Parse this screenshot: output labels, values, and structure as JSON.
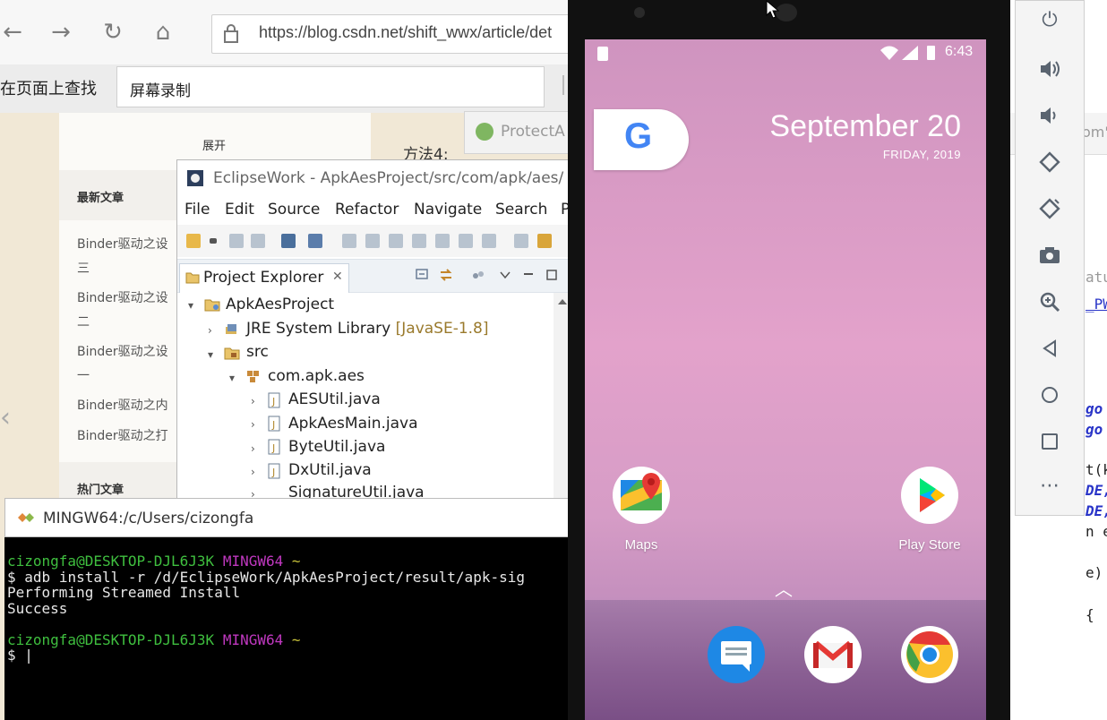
{
  "browser": {
    "url": "https://blog.csdn.net/shift_wwx/article/det",
    "find_label": "在页面上查找",
    "find_value": "屏幕录制",
    "sidebar": {
      "collapse": "展开",
      "latest_header": "最新文章",
      "latest_items": [
        "Binder驱动之设",
        "三",
        "Binder驱动之设",
        "二",
        "Binder驱动之设",
        "一",
        "Binder驱动之内",
        "Binder驱动之打"
      ],
      "hot_header": "热门文章"
    },
    "content_snippet": "方法4:"
  },
  "protect_window": {
    "title": "ProtectA"
  },
  "eclipse": {
    "title": "EclipseWork - ApkAesProject/src/com/apk/aes/",
    "menu": [
      "File",
      "Edit",
      "Source",
      "Refactor",
      "Navigate",
      "Search",
      "P"
    ],
    "view_tab": "Project Explorer",
    "tree": {
      "project": "ApkAesProject",
      "jre": "JRE System Library",
      "jre_decoration": "[JavaSE-1.8]",
      "src": "src",
      "package": "com.apk.aes",
      "files": [
        "AESUtil.java",
        "ApkAesMain.java",
        "ByteUtil.java",
        "DxUtil.java",
        "SignatureUtil.java"
      ]
    }
  },
  "terminal": {
    "title": "MINGW64:/c/Users/cizongfa",
    "user_host": "cizongfa@DESKTOP-DJL6J3K",
    "shell": "MINGW64",
    "cwd": "~",
    "prompt": "$",
    "command": "adb install -r /d/EclipseWork/ApkAesProject/result/apk-sig",
    "out1": "Performing Streamed Install",
    "out2": "Success",
    "cursor": "|"
  },
  "phone": {
    "time": "6:43",
    "google_letter": "G",
    "date": "September 20",
    "weekday": "FRIDAY, 2019",
    "apps": [
      {
        "label": "Maps"
      },
      {
        "label": "Play Store"
      }
    ],
    "dock": [
      "messages-icon",
      "gmail-icon",
      "chrome-icon"
    ]
  },
  "ide_right": {
    "tab_fragment": "om'",
    "lines": [
      "atu",
      "_PW",
      "go",
      "go",
      "t(k",
      "DE,",
      "DE,",
      "n e) {",
      "e) {",
      "{"
    ]
  }
}
